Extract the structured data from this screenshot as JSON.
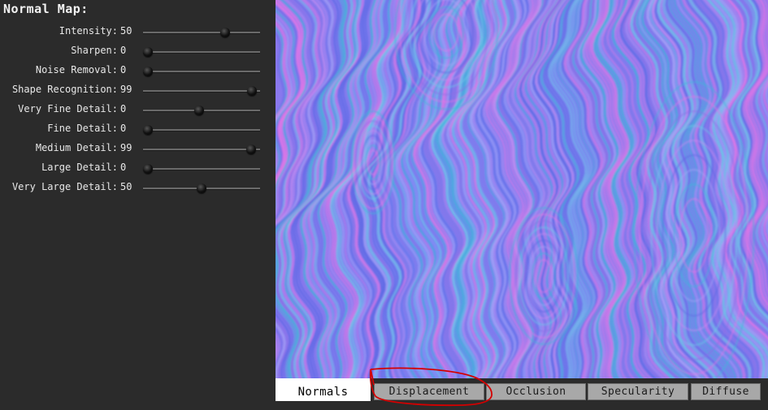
{
  "panel": {
    "title": "Normal Map:",
    "sliders": [
      {
        "label": "Intensity:",
        "value": "50",
        "position": 0.72
      },
      {
        "label": "Sharpen:",
        "value": "0",
        "position": 0.0
      },
      {
        "label": "Noise Removal:",
        "value": "0",
        "position": 0.0
      },
      {
        "label": "Shape Recognition:",
        "value": "99",
        "position": 0.97
      },
      {
        "label": "Very Fine Detail:",
        "value": "0",
        "position": 0.48
      },
      {
        "label": "Fine Detail:",
        "value": "0",
        "position": 0.0
      },
      {
        "label": "Medium Detail:",
        "value": "99",
        "position": 0.96
      },
      {
        "label": "Large Detail:",
        "value": "0",
        "position": 0.0
      },
      {
        "label": "Very Large Detail:",
        "value": "50",
        "position": 0.5
      }
    ]
  },
  "tabs": [
    {
      "label": "Normals",
      "active": true
    },
    {
      "label": "Displacement",
      "active": false
    },
    {
      "label": "Occlusion",
      "active": false
    },
    {
      "label": "Specularity",
      "active": false
    },
    {
      "label": "Diffuse",
      "active": false
    }
  ],
  "colors": {
    "annotation": "#d40000",
    "normal_blue": "#7d85f0",
    "normal_pink": "#e276e6",
    "normal_cyan": "#3fb6d8"
  }
}
